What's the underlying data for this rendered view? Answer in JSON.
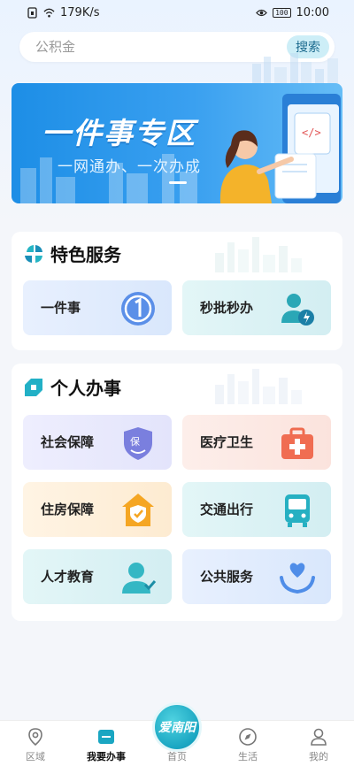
{
  "status_bar": {
    "speed": "179K/s",
    "battery": "100",
    "time": "10:00"
  },
  "search": {
    "placeholder": "公积金",
    "button_label": "搜索"
  },
  "banner": {
    "title": "一件事专区",
    "subtitle": "一网通办、一次办成"
  },
  "special_services": {
    "title": "特色服务",
    "items": [
      {
        "label": "一件事",
        "icon": "number-one-icon"
      },
      {
        "label": "秒批秒办",
        "icon": "person-lightning-icon"
      }
    ]
  },
  "personal_affairs": {
    "title": "个人办事",
    "items": [
      {
        "label": "社会保障",
        "icon": "insurance-shield-icon"
      },
      {
        "label": "医疗卫生",
        "icon": "medical-kit-icon"
      },
      {
        "label": "住房保障",
        "icon": "house-shield-icon"
      },
      {
        "label": "交通出行",
        "icon": "bus-icon"
      },
      {
        "label": "人才教育",
        "icon": "person-icon"
      },
      {
        "label": "公共服务",
        "icon": "heart-hands-icon"
      }
    ]
  },
  "bottom_nav": {
    "items": [
      {
        "label": "区域",
        "icon": "location-pin-icon"
      },
      {
        "label": "我要办事",
        "icon": "service-card-icon"
      },
      {
        "label": "首页",
        "icon": "home-logo-icon"
      },
      {
        "label": "生活",
        "icon": "compass-icon"
      },
      {
        "label": "我的",
        "icon": "user-icon"
      }
    ],
    "home_logo": "爱南阳",
    "active_color": "#1aa6c2"
  }
}
